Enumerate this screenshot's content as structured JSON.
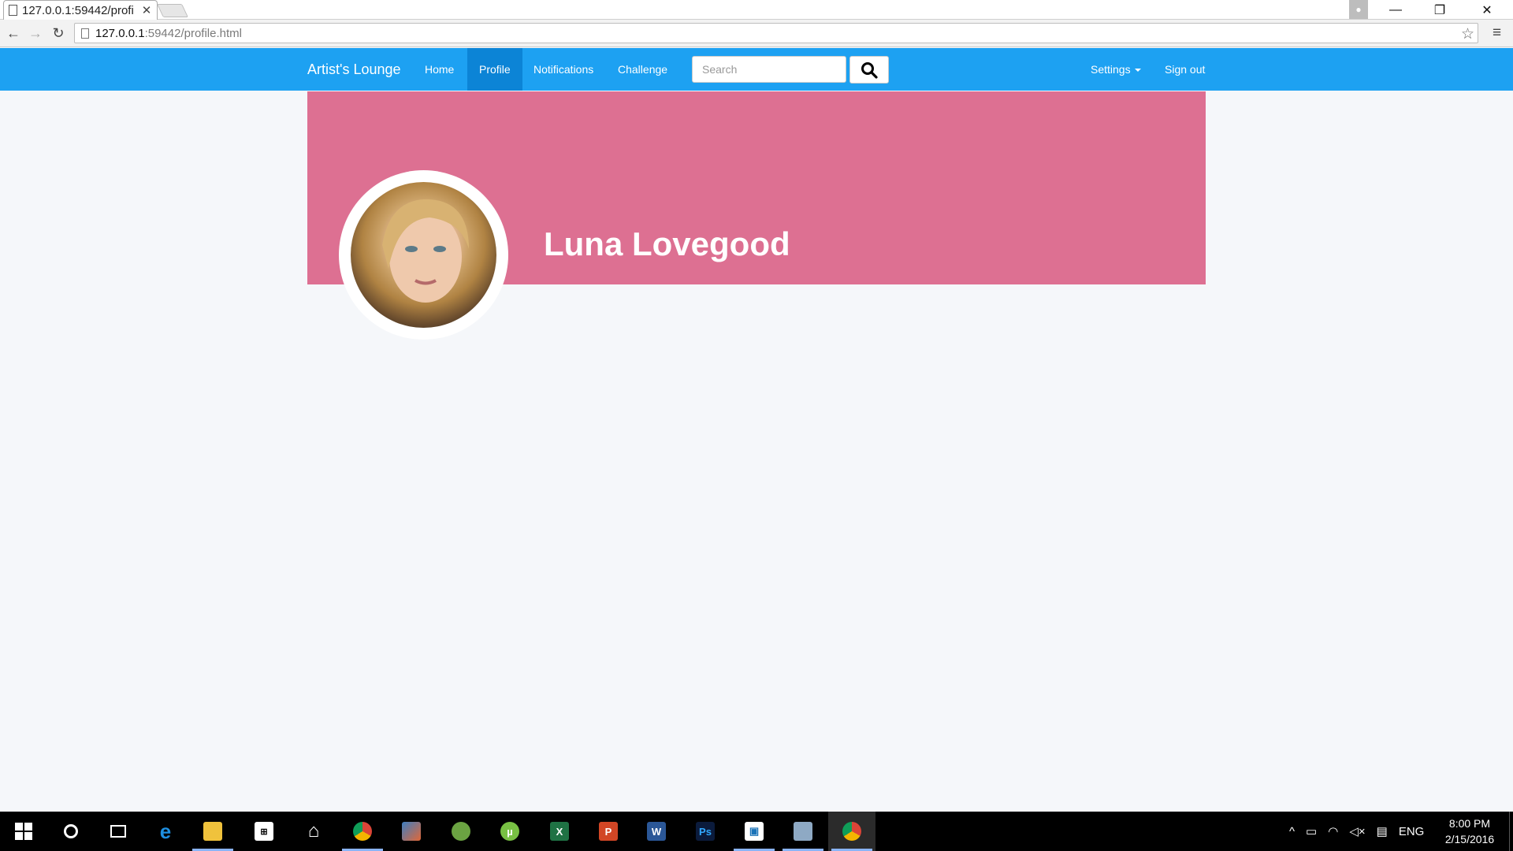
{
  "browser": {
    "tab_title": "127.0.0.1:59442/profi",
    "url_host": "127.0.0.1",
    "url_path": ":59442/profile.html"
  },
  "nav": {
    "brand": "Artist's Lounge",
    "home": "Home",
    "profile": "Profile",
    "notifications": "Notifications",
    "challenge": "Challenge",
    "search_placeholder": "Search",
    "settings": "Settings",
    "signout": "Sign out"
  },
  "profile": {
    "name": "Luna Lovegood",
    "cover_color": "#dd7092"
  },
  "colors": {
    "navbar": "#1da1f2",
    "nav_active": "#0c84d6",
    "page_bg": "#f5f7fa"
  },
  "taskbar": {
    "apps": [
      "windows-start",
      "cortana",
      "task-view",
      "edge",
      "file-explorer",
      "store",
      "home",
      "chrome",
      "matlab",
      "android-studio",
      "utorrent",
      "excel",
      "powerpoint",
      "word",
      "photoshop",
      "outlook-app",
      "remote-desktop",
      "chrome-active"
    ],
    "language": "ENG",
    "time": "8:00 PM",
    "date": "2/15/2016"
  }
}
